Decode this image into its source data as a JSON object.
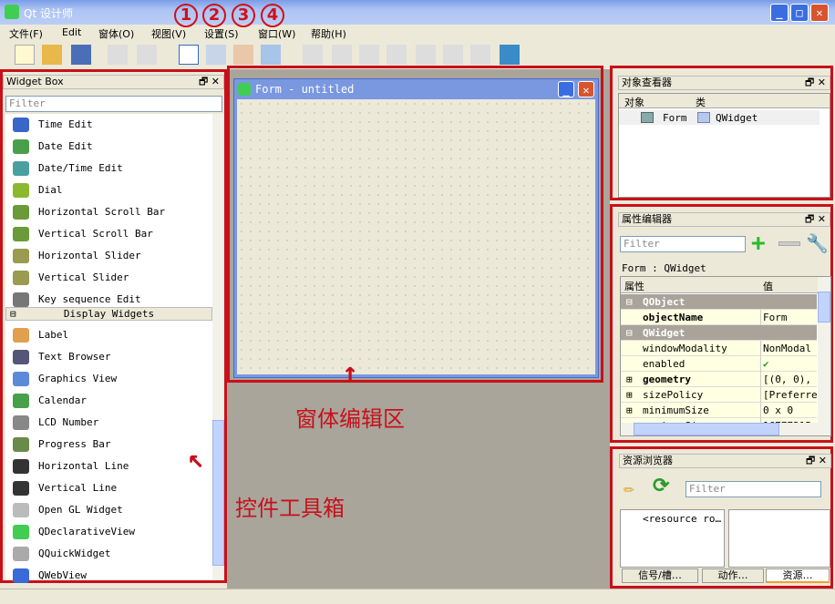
{
  "app": {
    "title": "Qt 设计师"
  },
  "menu": [
    "文件(F)",
    "Edit",
    "窗体(O)",
    "视图(V)",
    "设置(S)",
    "窗口(W)",
    "帮助(H)"
  ],
  "annotations": {
    "numbers": [
      "1",
      "2",
      "3",
      "4"
    ],
    "form_area": "窗体编辑区",
    "widget_box": "控件工具箱",
    "color": "#c8101a"
  },
  "widget_box": {
    "title": "Widget Box",
    "filter_placeholder": "Filter",
    "items_top": [
      {
        "label": "Time Edit",
        "icon": "clock-icon"
      },
      {
        "label": "Date Edit",
        "icon": "calendar-icon"
      },
      {
        "label": "Date/Time Edit",
        "icon": "datetime-icon"
      },
      {
        "label": "Dial",
        "icon": "dial-icon"
      },
      {
        "label": "Horizontal Scroll Bar",
        "icon": "hscrollbar-icon"
      },
      {
        "label": "Vertical Scroll Bar",
        "icon": "vscrollbar-icon"
      },
      {
        "label": "Horizontal Slider",
        "icon": "hslider-icon"
      },
      {
        "label": "Vertical Slider",
        "icon": "vslider-icon"
      },
      {
        "label": "Key sequence Edit",
        "icon": "keyseq-icon"
      }
    ],
    "category": "Display Widgets",
    "items_display": [
      {
        "label": "Label",
        "icon": "label-icon"
      },
      {
        "label": "Text Browser",
        "icon": "textbrowser-icon"
      },
      {
        "label": "Graphics View",
        "icon": "graphicsview-icon"
      },
      {
        "label": "Calendar",
        "icon": "calendar-icon"
      },
      {
        "label": "LCD Number",
        "icon": "lcd-icon"
      },
      {
        "label": "Progress Bar",
        "icon": "progressbar-icon"
      },
      {
        "label": "Horizontal Line",
        "icon": "hline-icon"
      },
      {
        "label": "Vertical Line",
        "icon": "vline-icon"
      },
      {
        "label": "Open GL Widget",
        "icon": "opengl-icon"
      },
      {
        "label": "QDeclarativeView",
        "icon": "qt-icon"
      },
      {
        "label": "QQuickWidget",
        "icon": "quick-icon"
      },
      {
        "label": "QWebView",
        "icon": "globe-icon"
      }
    ]
  },
  "form": {
    "title": "Form - untitled"
  },
  "object_inspector": {
    "title": "对象查看器",
    "col_object": "对象",
    "col_class": "类",
    "row_object": "Form",
    "row_class": "QWidget"
  },
  "property_editor": {
    "title": "属性编辑器",
    "filter_placeholder": "Filter",
    "context": "Form : QWidget",
    "col_prop": "属性",
    "col_value": "值",
    "rows": [
      {
        "k": "QObject",
        "group": true
      },
      {
        "k": "objectName",
        "v": "Form",
        "bold": true
      },
      {
        "k": "QWidget",
        "group": true
      },
      {
        "k": "windowModality",
        "v": "NonModal"
      },
      {
        "k": "enabled",
        "v": "✔"
      },
      {
        "k": "geometry",
        "v": "[(0, 0), 400",
        "bold": true,
        "expand": true
      },
      {
        "k": "sizePolicy",
        "v": "[Preferred,",
        "expand": true
      },
      {
        "k": "minimumSize",
        "v": "0 x 0",
        "expand": true
      },
      {
        "k": "maximumSize",
        "v": "16777215 x",
        "expand": true
      }
    ]
  },
  "resource_browser": {
    "title": "资源浏览器",
    "filter_placeholder": "Filter",
    "root": "<resource ro…"
  },
  "bottom_tabs": [
    "信号/槽…",
    "动作…",
    "资源…"
  ],
  "active_tab": 2
}
